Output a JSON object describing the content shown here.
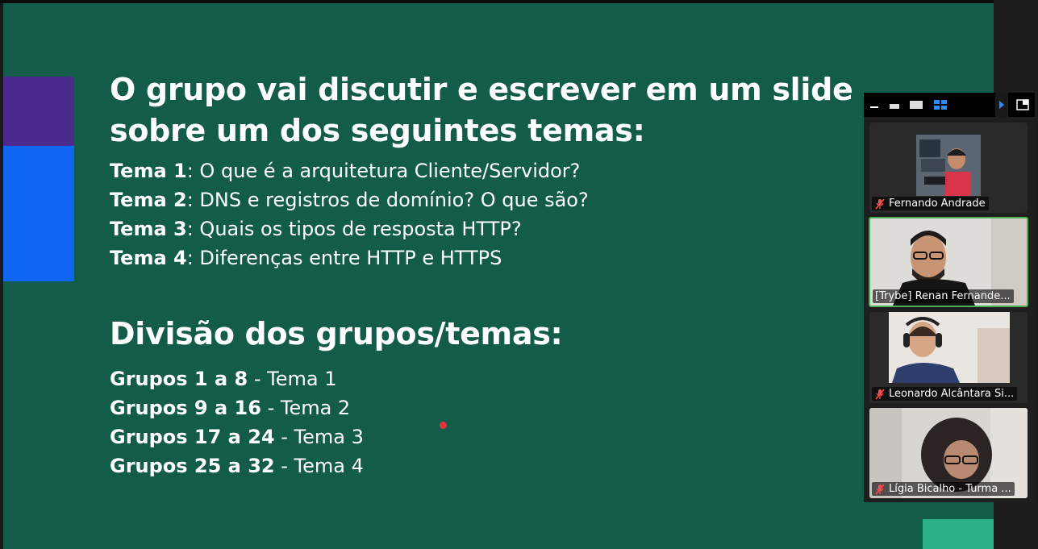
{
  "slide": {
    "title_line1": "O grupo vai discutir e escrever em um slide",
    "title_line2": "sobre um dos seguintes temas:",
    "topics": [
      {
        "label": "Tema 1",
        "text": ": O que é a arquitetura Cliente/Servidor?"
      },
      {
        "label": "Tema 2",
        "text": ": DNS e registros de domínio? O que são?"
      },
      {
        "label": "Tema 3",
        "text": ": Quais os tipos de resposta HTTP?"
      },
      {
        "label": "Tema 4",
        "text": ": Diferenças entre HTTP e HTTPS"
      }
    ],
    "subtitle": "Divisão dos grupos/temas:",
    "groups": [
      {
        "label": "Grupos 1 a 8",
        "text": " - Tema 1"
      },
      {
        "label": "Grupos 9 a 16",
        "text": " - Tema 2"
      },
      {
        "label": "Grupos 17 a 24",
        "text": " - Tema 3"
      },
      {
        "label": "Grupos 25 a 32",
        "text": " - Tema 4"
      }
    ],
    "colors": {
      "background": "#135c4a",
      "accent_purple": "#4a2a8c",
      "accent_blue": "#0f66f5",
      "accent_mint": "#2cb08a",
      "pointer": "#e8323c"
    }
  },
  "participants_panel": {
    "toolbar_icons": [
      "minimize-icon",
      "strip-view-icon",
      "speaker-view-icon",
      "gallery-view-icon",
      "next-page-icon",
      "exit-fullscreen-icon"
    ],
    "participants": [
      {
        "name": "Fernando Andrade",
        "muted": true,
        "active_speaker": false
      },
      {
        "name": "[Trybe] Renan Fernande...",
        "muted": false,
        "active_speaker": true
      },
      {
        "name": "Leonardo Alcântara Si...",
        "muted": true,
        "active_speaker": false
      },
      {
        "name": "Lígia Bicalho - Turma ...",
        "muted": true,
        "active_speaker": false
      }
    ]
  }
}
